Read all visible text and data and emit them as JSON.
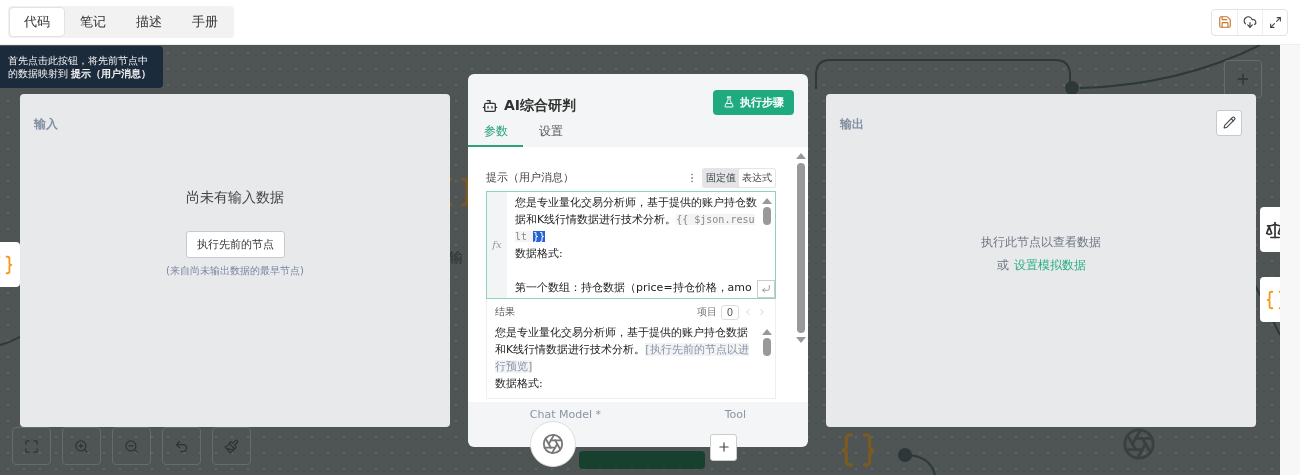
{
  "header": {
    "tabs": [
      {
        "label": "代码",
        "selected": true
      },
      {
        "label": "笔记",
        "selected": false
      },
      {
        "label": "描述",
        "selected": false
      },
      {
        "label": "手册",
        "selected": false
      }
    ]
  },
  "tooltip": {
    "text": "首先点击此按钮，将先前节点中的数据映射到 **提示（用户消息）**"
  },
  "canvas": {
    "node_label": "输"
  },
  "input_panel": {
    "title": "输入",
    "empty_message": "尚未有输入数据",
    "button": "执行先前的节点",
    "hint": "(来自尚未输出数据的最早节点)"
  },
  "node_panel": {
    "title": "AI综合研判",
    "run_button": "执行步骤",
    "tabs": [
      {
        "label": "参数",
        "selected": true
      },
      {
        "label": "设置",
        "selected": false
      }
    ],
    "prompt": {
      "label": "提示（用户消息）",
      "modes": [
        {
          "label": "固定值",
          "selected": false
        },
        {
          "label": "表达式",
          "selected": true
        }
      ],
      "gutter": "fx",
      "text": "您是专业量化交易分析师，基于提供的账户持仓数据和K线行情数据进行技术分析。",
      "expression": "{{ $json.result ",
      "expression_end": "}}",
      "lines": [
        "数据格式:",
        "第一个数组：持仓数据（price=持仓价格，amo"
      ]
    },
    "result": {
      "label": "结果",
      "item_label": "项目",
      "item_value": "0",
      "text": "您是专业量化交易分析师，基于提供的账户持仓数据和K线行情数据进行技术分析。",
      "placeholder_note": "[执行先前的节点以进行预览]",
      "lines": [
        "数据格式:"
      ]
    },
    "connectors": [
      {
        "label": "Chat Model *"
      },
      {
        "label": "Tool"
      }
    ]
  },
  "output_panel": {
    "title": "输出",
    "message": "执行此节点以查看数据",
    "alt_prefix": "或",
    "alt_link": "设置模拟数据"
  }
}
